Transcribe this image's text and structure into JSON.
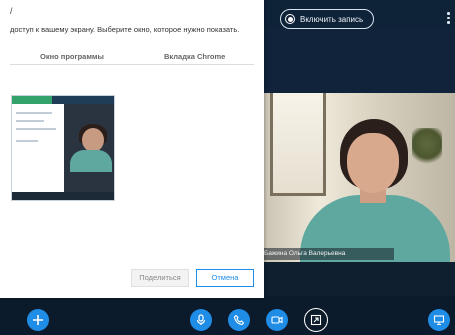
{
  "header": {
    "record_button_label": "Включить запись"
  },
  "dialog": {
    "title": "/",
    "subtitle": "доступ к вашему экрану. Выберите окно, которое нужно показать.",
    "tabs": [
      {
        "label": "Окно программы"
      },
      {
        "label": "Вкладка Chrome"
      }
    ],
    "share_button_label": "Поделиться",
    "cancel_button_label": "Отмена"
  },
  "video": {
    "participant_name": "Бажина Ольга Валерьевна"
  },
  "colors": {
    "accent": "#1f8ce6",
    "call_bg": "#0f1f30",
    "dialog_bg": "#ffffff"
  },
  "icons": {
    "record": "record-icon",
    "more": "more-vert-icon",
    "add": "plus-icon",
    "mic": "mic-icon",
    "call": "phone-icon",
    "camera": "video-camera-icon",
    "screen_share": "screen-share-icon",
    "present": "presentation-icon"
  }
}
